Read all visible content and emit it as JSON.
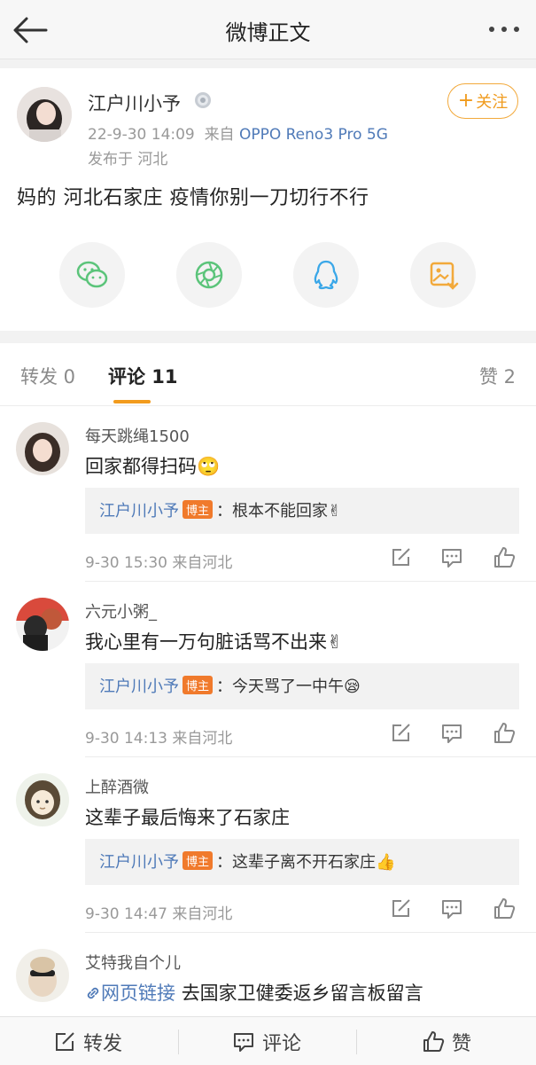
{
  "header": {
    "title": "微博正文",
    "back_icon": "back-arrow-icon",
    "more_icon": "more-dots-icon"
  },
  "post": {
    "author": "江户川小予",
    "badge_icon": "silver-medal-icon",
    "time": "22-9-30 14:09",
    "via_prefix": "来自",
    "device": "OPPO Reno3 Pro 5G",
    "location": "发布于 河北",
    "follow_label": "关注",
    "text": "妈的 河北石家庄 疫情你别一刀切行不行",
    "share_icons": [
      "wechat-icon",
      "moments-icon",
      "qq-icon",
      "save-image-icon"
    ]
  },
  "tabs": {
    "repost": "转发 0",
    "comment": "评论 11",
    "like": "赞 2"
  },
  "comments": [
    {
      "user": "每天跳绳1500",
      "text": "回家都得扫码🙄",
      "reply_author": "江户川小予",
      "host_label": "博主",
      "reply_text": "：根本不能回家✌",
      "time": "9-30 15:30",
      "via": "来自河北"
    },
    {
      "user": "六元小粥_",
      "text": "我心里有一万句脏话骂不出来✌",
      "reply_author": "江户川小予",
      "host_label": "博主",
      "reply_text": "：今天骂了一中午😪",
      "time": "9-30 14:13",
      "via": "来自河北"
    },
    {
      "user": "上醉酒微",
      "text": "这辈子最后悔来了石家庄",
      "reply_author": "江户川小予",
      "host_label": "博主",
      "reply_text": "：这辈子离不开石家庄👍",
      "time": "9-30 14:47",
      "via": "来自河北"
    },
    {
      "user": "艾特我自个儿",
      "link_label": "网页链接",
      "text": "去国家卫健委返乡留言板留言"
    }
  ],
  "bottom_bar": {
    "repost": "转发",
    "comment": "评论",
    "like": "赞"
  },
  "colors": {
    "accent": "#f09b1d",
    "link": "#4f7ab8",
    "host_badge": "#f07a2c"
  }
}
